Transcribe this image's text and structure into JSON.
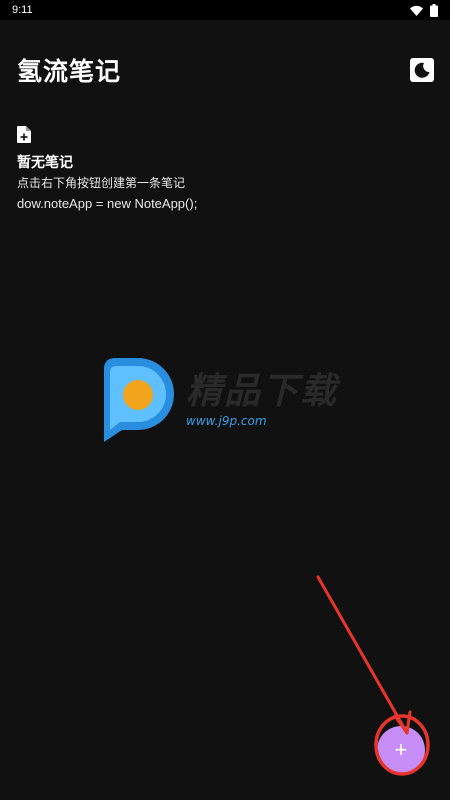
{
  "status_bar": {
    "time": "9:11"
  },
  "header": {
    "title": "氢流笔记"
  },
  "theme_toggle": {
    "icon": "moon-icon"
  },
  "empty_state": {
    "icon": "note-add-icon",
    "title": "暂无笔记",
    "hint": "点击右下角按钮创建第一条笔记",
    "code_snippet": "dow.noteApp = new NoteApp();"
  },
  "watermark": {
    "title": "精品下载",
    "url": "www.j9p.com"
  },
  "fab": {
    "label": "+",
    "icon": "add-icon"
  },
  "colors": {
    "background": "#111111",
    "accent": "#c58df5",
    "annotation": "#e8352a"
  }
}
